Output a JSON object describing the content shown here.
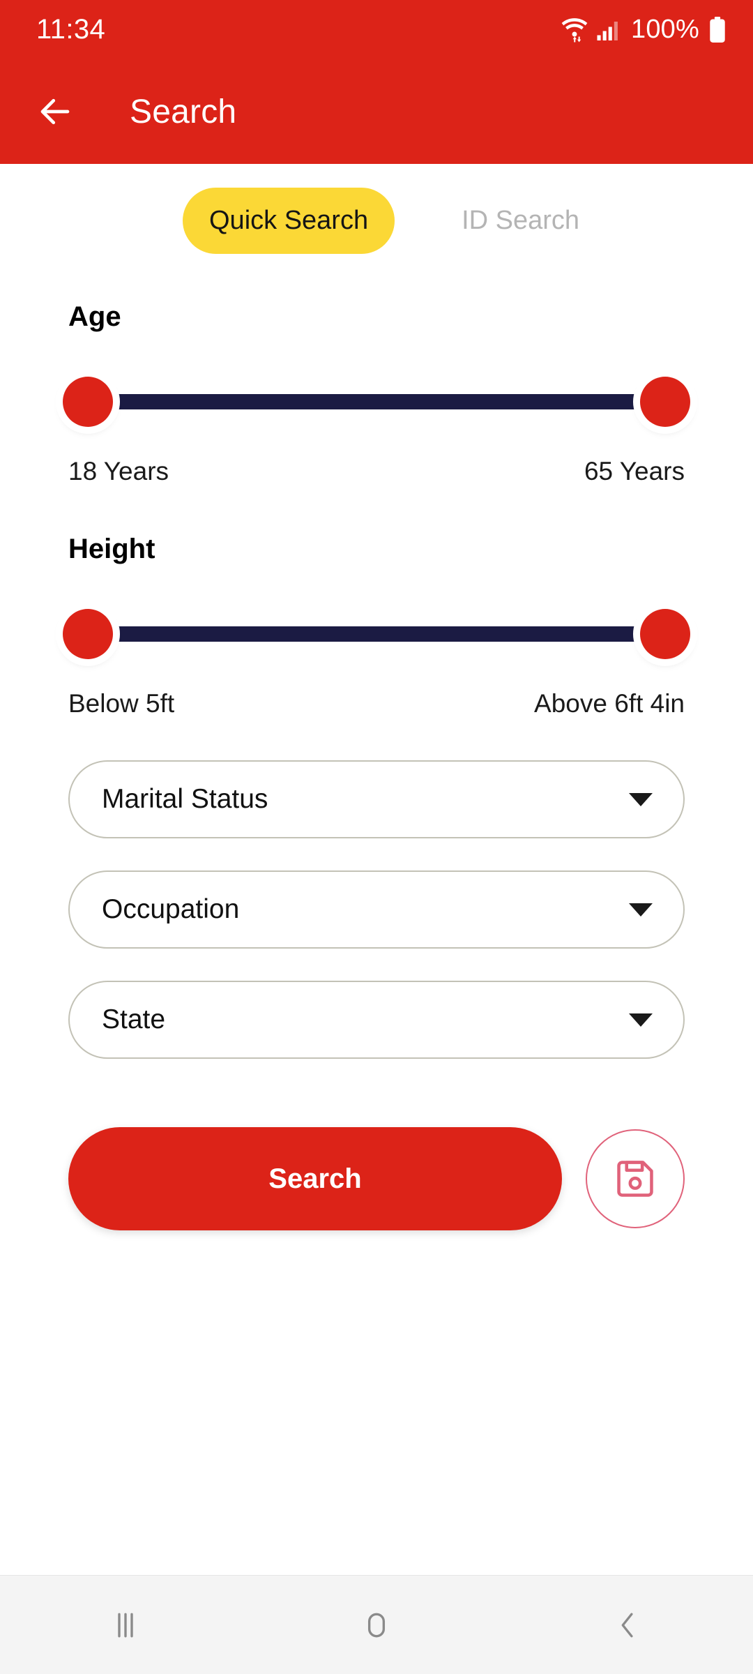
{
  "status_bar": {
    "clock": "11:34",
    "battery_percent": "100%",
    "icons": {
      "wifi": "wifi-icon",
      "signal": "signal-icon",
      "battery": "battery-icon"
    }
  },
  "app_bar": {
    "back_icon": "back-arrow-icon",
    "title": "Search"
  },
  "tabs": [
    {
      "label": "Quick Search",
      "active": true
    },
    {
      "label": "ID Search",
      "active": false
    }
  ],
  "filters": {
    "age": {
      "label": "Age",
      "min_label": "18 Years",
      "max_label": "65 Years"
    },
    "height": {
      "label": "Height",
      "min_label": "Below 5ft",
      "max_label": "Above 6ft 4in"
    },
    "dropdowns": [
      {
        "label": "Marital Status"
      },
      {
        "label": "Occupation"
      },
      {
        "label": "State"
      }
    ]
  },
  "actions": {
    "search_label": "Search",
    "save_icon": "save-floppy-icon"
  },
  "nav_bar": {
    "recents_icon": "recents-icon",
    "home_icon": "home-icon",
    "back_icon": "back-chevron-icon"
  },
  "colors": {
    "brand_red": "#DC2318",
    "accent_yellow": "#FBD836",
    "track_navy": "#1B1B43",
    "border_taupe": "#C3C2B6",
    "save_pink": "#E0627A",
    "inactive_gray": "#B4B4B4"
  }
}
